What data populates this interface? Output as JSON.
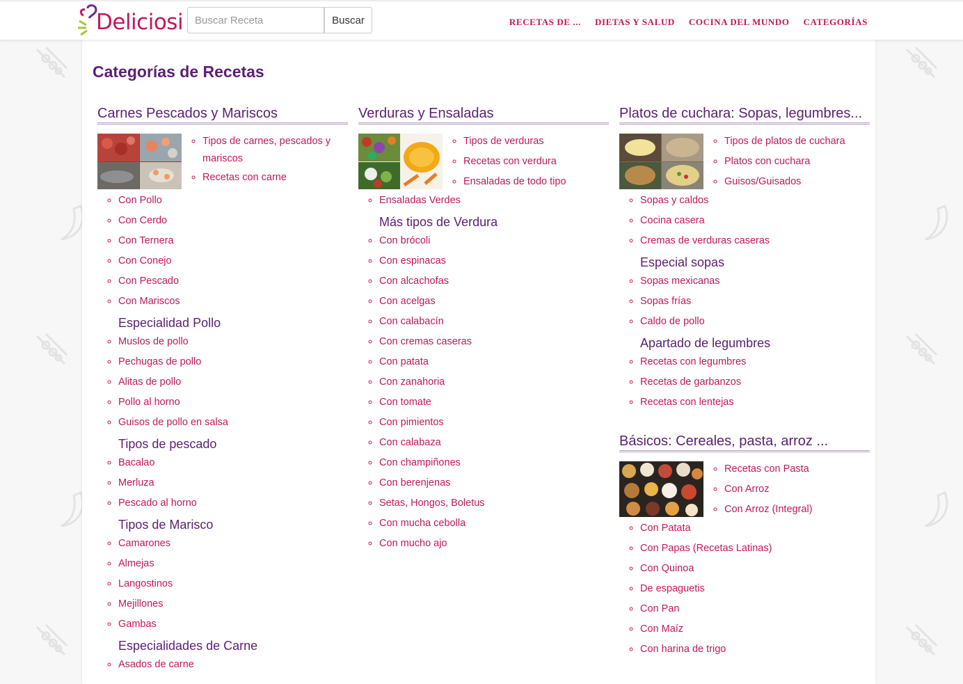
{
  "header": {
    "logo_text": "Deliciosi",
    "search_placeholder": "Buscar Receta",
    "search_button": "Buscar",
    "nav": [
      "RECETAS DE ...",
      "DIETAS Y SALUD",
      "COCINA DEL MUNDO",
      "CATEGORÍAS"
    ]
  },
  "page_title": "Categorías de Recetas",
  "columns": [
    {
      "title": "Carnes Pescados y Mariscos",
      "featured": [
        "Tipos de carnes, pescados y mariscos",
        "Recetas con carne"
      ],
      "items": [
        "Con Pollo",
        "Con Cerdo",
        "Con Ternera",
        "Con Conejo",
        "Con Pescado",
        "Con Mariscos"
      ],
      "groups": [
        {
          "heading": "Especialidad Pollo",
          "items": [
            "Muslos de pollo",
            "Pechugas de pollo",
            "Alitas de pollo",
            "Pollo al horno",
            "Guisos de pollo en salsa"
          ]
        },
        {
          "heading": "Tipos de pescado",
          "items": [
            "Bacalao",
            "Merluza",
            "Pescado al horno"
          ]
        },
        {
          "heading": "Tipos de Marisco",
          "items": [
            "Camarones",
            "Almejas",
            "Langostinos",
            "Mejillones",
            "Gambas"
          ]
        },
        {
          "heading": "Especialidades de Carne",
          "items": [
            "Asados de carne"
          ]
        }
      ]
    },
    {
      "title": "Verduras y Ensaladas",
      "featured": [
        "Tipos de verduras",
        "Recetas con verdura",
        "Ensaladas de todo tipo"
      ],
      "items": [
        "Ensaladas Verdes"
      ],
      "groups": [
        {
          "heading": "Más tipos de Verdura",
          "items": [
            "Con brócoli",
            "Con espinacas",
            "Con alcachofas",
            "Con acelgas",
            "Con calabacín",
            "Con cremas caseras",
            "Con patata",
            "Con zanahoria",
            "Con tomate",
            "Con pimientos",
            "Con calabaza",
            "Con champiñones",
            "Con berenjenas",
            "Setas, Hongos, Boletus",
            "Con mucha cebolla",
            "Con mucho ajo"
          ]
        }
      ]
    },
    {
      "title": "Platos de cuchara: Sopas, legumbres...",
      "featured": [
        "Tipos de platos de cuchara",
        "Platos con cuchara",
        "Guisos/Guisados"
      ],
      "items": [
        "Sopas y caldos",
        "Cocina casera",
        "Cremas de verduras caseras"
      ],
      "groups": [
        {
          "heading": "Especial sopas",
          "items": [
            "Sopas mexicanas",
            "Sopas frías",
            "Caldo de pollo"
          ]
        },
        {
          "heading": "Apartado de legumbres",
          "items": [
            "Recetas con legumbres",
            "Recetas de garbanzos",
            "Recetas con lentejas"
          ]
        }
      ]
    },
    {
      "title": "Básicos: Cereales, pasta, arroz ...",
      "featured": [
        "Recetas con Pasta",
        "Con Arroz",
        "Con Arroz (Integral)"
      ],
      "items": [
        "Con Patata",
        "Con Papas (Recetas Latinas)",
        "Con Quinoa",
        "De espaguetis",
        "Con Pan",
        "Con Maíz",
        "Con harina de trigo"
      ],
      "groups": []
    }
  ],
  "colors": {
    "brand": "#c2185b",
    "heading": "#5b1f73"
  },
  "icons": [
    "logo-mark-icon",
    "skewer-icon",
    "banana-icon"
  ]
}
